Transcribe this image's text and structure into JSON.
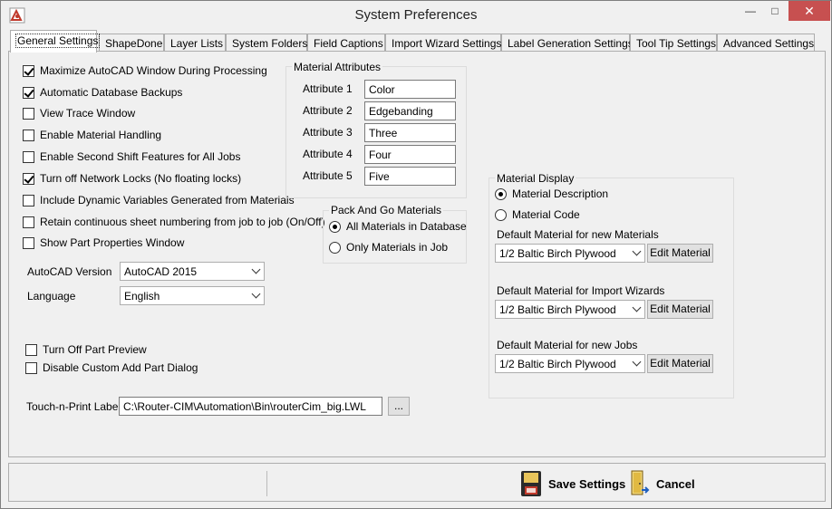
{
  "window": {
    "title": "System Preferences",
    "min": "—",
    "max": "□",
    "close": "✕"
  },
  "tabs": [
    {
      "label": "General Settings"
    },
    {
      "label": "ShapeDone"
    },
    {
      "label": "Layer Lists"
    },
    {
      "label": "System Folders"
    },
    {
      "label": "Field Captions"
    },
    {
      "label": "Import Wizard Settings"
    },
    {
      "label": "Label Generation Settings"
    },
    {
      "label": "Tool Tip Settings"
    },
    {
      "label": "Advanced Settings"
    }
  ],
  "options": [
    {
      "label": "Maximize AutoCAD Window During Processing",
      "checked": true
    },
    {
      "label": "Automatic Database Backups",
      "checked": true
    },
    {
      "label": "View Trace Window",
      "checked": false
    },
    {
      "label": "Enable Material Handling",
      "checked": false
    },
    {
      "label": "Enable Second Shift Features for All Jobs",
      "checked": false
    },
    {
      "label": "Turn off Network Locks (No floating locks)",
      "checked": true
    },
    {
      "label": "Include Dynamic Variables Generated from Materials",
      "checked": false
    },
    {
      "label": "Retain continuous sheet numbering from job to job (On/Off)",
      "checked": false
    },
    {
      "label": "Show Part Properties Window",
      "checked": false
    }
  ],
  "autocad": {
    "label": "AutoCAD Version",
    "value": "AutoCAD 2015"
  },
  "language": {
    "label": "Language",
    "value": "English"
  },
  "preview_options": [
    {
      "label": "Turn Off Part Preview",
      "checked": false
    },
    {
      "label": "Disable Custom Add Part Dialog",
      "checked": false
    }
  ],
  "touch_print": {
    "label": "Touch-n-Print Label",
    "value": "C:\\Router-CIM\\Automation\\Bin\\routerCim_big.LWL",
    "browse": "..."
  },
  "material_attributes": {
    "title": "Material Attributes",
    "items": [
      {
        "label": "Attribute 1",
        "value": "Color"
      },
      {
        "label": "Attribute 2",
        "value": "Edgebanding"
      },
      {
        "label": "Attribute 3",
        "value": "Three"
      },
      {
        "label": "Attribute 4",
        "value": "Four"
      },
      {
        "label": "Attribute 5",
        "value": "Five"
      }
    ]
  },
  "pack_and_go": {
    "title": "Pack And Go Materials",
    "options": [
      {
        "label": "All Materials in Database",
        "selected": true
      },
      {
        "label": "Only Materials in Job",
        "selected": false
      }
    ]
  },
  "material_display": {
    "title": "Material Display",
    "options": [
      {
        "label": "Material Description",
        "selected": true
      },
      {
        "label": "Material Code",
        "selected": false
      }
    ],
    "defaults": [
      {
        "label": "Default Material for new Materials",
        "value": "1/2 Baltic Birch Plywood",
        "button": "Edit Material"
      },
      {
        "label": "Default Material for Import Wizards",
        "value": "1/2 Baltic Birch Plywood",
        "button": "Edit Material"
      },
      {
        "label": "Default Material for new Jobs",
        "value": "1/2 Baltic Birch Plywood",
        "button": "Edit Material"
      }
    ]
  },
  "footer": {
    "save": "Save Settings",
    "cancel": "Cancel"
  }
}
